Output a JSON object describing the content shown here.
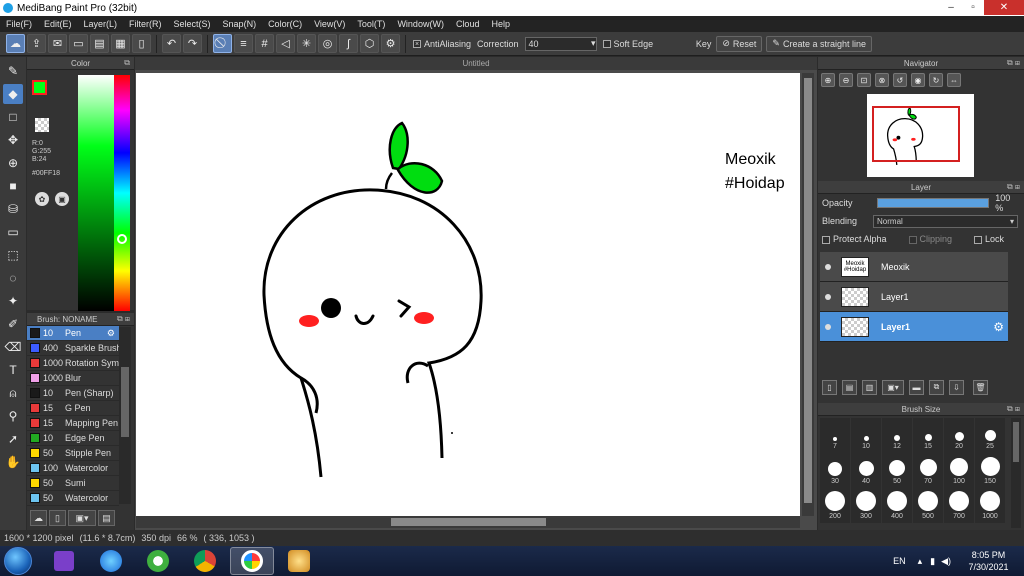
{
  "window": {
    "title": "MediBang Paint Pro (32bit)",
    "minimize": "–",
    "maximize": "▫",
    "close": "✕"
  },
  "menu": [
    "File(F)",
    "Edit(E)",
    "Layer(L)",
    "Filter(R)",
    "Select(S)",
    "Snap(N)",
    "Color(C)",
    "View(V)",
    "Tool(T)",
    "Window(W)",
    "Cloud",
    "Help"
  ],
  "toolbar": {
    "antialiasing_label": "AntiAliasing",
    "correction_label": "Correction",
    "correction_value": "40",
    "soft_edge_label": "Soft Edge",
    "key_label": "Key",
    "reset_label": "Reset",
    "straight_line_label": "Create a straight line"
  },
  "color_panel": {
    "title": "Color",
    "r": "R:0",
    "g": "G:255",
    "b": "B:24",
    "hex": "#00FF18",
    "foreground": "#00ff18"
  },
  "brush_panel": {
    "title": "Brush: NONAME",
    "items": [
      {
        "size": "10",
        "name": "Pen",
        "color": "#1a1a1a"
      },
      {
        "size": "400",
        "name": "Sparkle Brush",
        "color": "#3c5cff"
      },
      {
        "size": "1000",
        "name": "Rotation Sym",
        "color": "#e83a3a"
      },
      {
        "size": "1000",
        "name": "Blur",
        "color": "#f0a0e8"
      },
      {
        "size": "10",
        "name": "Pen (Sharp)",
        "color": "#1a1a1a"
      },
      {
        "size": "15",
        "name": "G Pen",
        "color": "#e83a3a"
      },
      {
        "size": "15",
        "name": "Mapping Pen",
        "color": "#e83a3a"
      },
      {
        "size": "10",
        "name": "Edge Pen",
        "color": "#22aa22"
      },
      {
        "size": "50",
        "name": "Stipple Pen",
        "color": "#ffd800"
      },
      {
        "size": "100",
        "name": "Watercolor",
        "color": "#6cc4f0"
      },
      {
        "size": "50",
        "name": "Sumi",
        "color": "#ffd800"
      },
      {
        "size": "50",
        "name": "Watercolor",
        "color": "#6cc4f0"
      }
    ]
  },
  "document": {
    "tab": "Untitled",
    "text_line1": "Meoxik",
    "text_line2": "#Hoidap"
  },
  "navigator": {
    "title": "Navigator"
  },
  "layer_panel": {
    "title": "Layer",
    "opacity_label": "Opacity",
    "opacity_value": "100 %",
    "opacity_level": 100,
    "blending_label": "Blending",
    "blending_value": "Normal",
    "protect_alpha": "Protect Alpha",
    "clipping": "Clipping",
    "lock": "Lock",
    "layers": [
      {
        "name": "Meoxik",
        "thumb_text": "Meoxik #Hoidap"
      },
      {
        "name": "Layer1"
      },
      {
        "name": "Layer1"
      }
    ]
  },
  "brush_size": {
    "title": "Brush Size",
    "sizes": [
      "7",
      "10",
      "12",
      "15",
      "20",
      "25",
      "30",
      "40",
      "50",
      "70",
      "100",
      "150",
      "200",
      "300",
      "400",
      "500",
      "700",
      "1000"
    ]
  },
  "status": {
    "pixels": "1600 * 1200 pixel",
    "cm": "(11.6 * 8.7cm)",
    "dpi": "350 dpi",
    "zoom": "66 %",
    "coords": "( 336, 1053 )"
  },
  "taskbar": {
    "lang": "EN",
    "time": "8:05 PM",
    "date": "7/30/2021"
  }
}
